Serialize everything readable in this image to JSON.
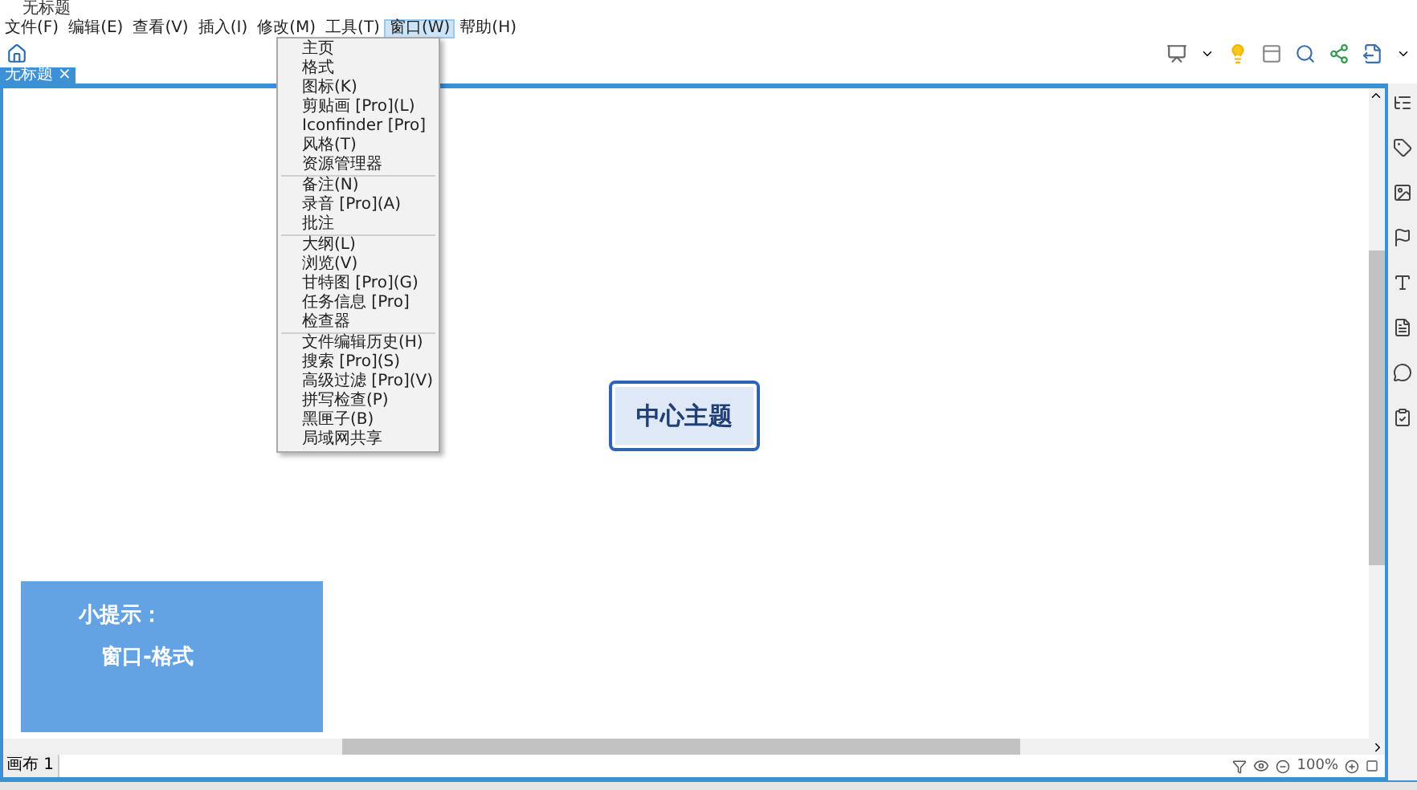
{
  "window": {
    "title": "无标题"
  },
  "menubar": [
    {
      "label": "文件(F)",
      "selected": false
    },
    {
      "label": "编辑(E)",
      "selected": false
    },
    {
      "label": "查看(V)",
      "selected": false
    },
    {
      "label": "插入(I)",
      "selected": false
    },
    {
      "label": "修改(M)",
      "selected": false
    },
    {
      "label": "工具(T)",
      "selected": false
    },
    {
      "label": "窗口(W)",
      "selected": true
    },
    {
      "label": "帮助(H)",
      "selected": false
    }
  ],
  "dropdown": {
    "groups": [
      [
        "主页",
        "格式",
        "图标(K)",
        "剪贴画 [Pro](L)",
        "Iconfinder [Pro]",
        "风格(T)",
        "资源管理器"
      ],
      [
        "备注(N)",
        "录音 [Pro](A)",
        "批注"
      ],
      [
        "大纲(L)",
        "浏览(V)",
        "甘特图 [Pro](G)",
        "任务信息 [Pro]",
        "检查器"
      ],
      [
        "文件编辑历史(H)",
        "搜索 [Pro](S)",
        "高级过滤 [Pro](V)",
        "拼写检查(P)",
        "黑匣子(B)",
        "局域网共享"
      ]
    ]
  },
  "document_tab": {
    "label": "无标题",
    "close": "×"
  },
  "central_topic": "中心主题",
  "tip": {
    "title": "小提示：",
    "body": "窗口-格式"
  },
  "sheet_tab": "画布 1",
  "zoom": "100%"
}
